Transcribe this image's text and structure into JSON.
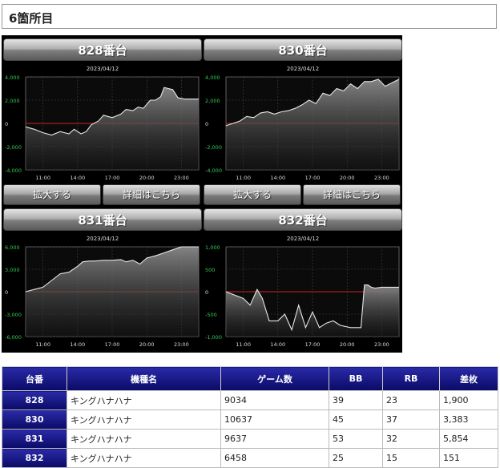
{
  "page": {
    "title": "6箇所目"
  },
  "colors": {
    "header_blue": "#0a0a66",
    "zero_line": "#cc2222",
    "axis_text": "#33cc55"
  },
  "slots": [
    {
      "label": "828番台",
      "date": "2023/04/12",
      "btn_zoom": "拡大する",
      "btn_detail": "詳細はこちら",
      "chart_data": {
        "type": "area",
        "y_ticks": [
          "4,000",
          "2,000",
          "0",
          "-2,000",
          "-4,000"
        ],
        "ylim": [
          -4000,
          4000
        ],
        "x_ticks": [
          "11:00",
          "14:00",
          "17:00",
          "20:00",
          "23:00"
        ],
        "x": [
          0,
          0.05,
          0.1,
          0.15,
          0.2,
          0.25,
          0.28,
          0.32,
          0.35,
          0.38,
          0.42,
          0.45,
          0.5,
          0.55,
          0.58,
          0.62,
          0.65,
          0.68,
          0.72,
          0.75,
          0.78,
          0.8,
          0.85,
          0.88,
          0.92,
          1
        ],
        "values": [
          -300,
          -500,
          -800,
          -1000,
          -700,
          -900,
          -500,
          -900,
          -700,
          -100,
          200,
          700,
          500,
          800,
          1200,
          1100,
          1400,
          1300,
          2000,
          2000,
          2300,
          3100,
          2900,
          2200,
          2100,
          2100
        ]
      }
    },
    {
      "label": "830番台",
      "date": "2023/04/12",
      "btn_zoom": "拡大する",
      "btn_detail": "詳細はこちら",
      "chart_data": {
        "type": "area",
        "y_ticks": [
          "4,000",
          "2,000",
          "0",
          "-2,000",
          "-4,000"
        ],
        "ylim": [
          -4000,
          4000
        ],
        "x_ticks": [
          "11:00",
          "14:00",
          "17:00",
          "20:00",
          "23:00"
        ],
        "x": [
          0,
          0.04,
          0.08,
          0.12,
          0.16,
          0.2,
          0.24,
          0.28,
          0.32,
          0.36,
          0.4,
          0.44,
          0.48,
          0.52,
          0.56,
          0.6,
          0.64,
          0.68,
          0.72,
          0.76,
          0.8,
          0.84,
          0.88,
          0.92,
          1
        ],
        "values": [
          -200,
          0,
          200,
          600,
          500,
          900,
          1000,
          800,
          1000,
          1100,
          1300,
          1600,
          2000,
          1700,
          2600,
          2400,
          3000,
          2800,
          3400,
          3000,
          3600,
          3600,
          3800,
          3200,
          3800
        ]
      }
    },
    {
      "label": "831番台",
      "date": "2023/04/12",
      "btn_zoom": "拡大する",
      "btn_detail": "詳細はこちら",
      "chart_data": {
        "type": "area",
        "y_ticks": [
          "6,000",
          "3,000",
          "0",
          "-3,000",
          "-6,000"
        ],
        "ylim": [
          -6000,
          6000
        ],
        "x_ticks": [
          "11:00",
          "14:00",
          "17:00",
          "20:00",
          "23:00"
        ],
        "x": [
          0,
          0.05,
          0.1,
          0.15,
          0.2,
          0.25,
          0.3,
          0.33,
          0.37,
          0.4,
          0.45,
          0.5,
          0.55,
          0.58,
          0.62,
          0.66,
          0.7,
          0.75,
          0.8,
          0.85,
          0.9,
          1
        ],
        "values": [
          0,
          300,
          600,
          1500,
          2400,
          2600,
          3400,
          4000,
          4100,
          4100,
          4200,
          4200,
          4300,
          4000,
          4200,
          3700,
          4500,
          4800,
          5200,
          5600,
          6000,
          6000
        ]
      }
    },
    {
      "label": "832番台",
      "date": "2023/04/12",
      "btn_zoom": "拡大する",
      "btn_detail": "詳細はこちら",
      "chart_data": {
        "type": "area",
        "y_ticks": [
          "1,000",
          "500",
          "0",
          "-500",
          "-1,000"
        ],
        "ylim": [
          -1000,
          1000
        ],
        "x_ticks": [
          "11:00",
          "14:00",
          "17:00",
          "20:00",
          "23:00"
        ],
        "x": [
          0,
          0.1,
          0.14,
          0.18,
          0.21,
          0.25,
          0.3,
          0.34,
          0.38,
          0.42,
          0.46,
          0.5,
          0.54,
          0.58,
          0.62,
          0.66,
          0.72,
          0.78,
          0.8,
          0.82,
          0.84,
          0.86,
          0.9,
          1
        ],
        "values": [
          0,
          -150,
          -300,
          50,
          -150,
          -650,
          -650,
          -500,
          -850,
          -300,
          -800,
          -450,
          -800,
          -700,
          -650,
          -750,
          -800,
          -800,
          150,
          150,
          100,
          80,
          100,
          100
        ]
      }
    }
  ],
  "table": {
    "headers": [
      "台番",
      "機種名",
      "ゲーム数",
      "BB",
      "RB",
      "差枚"
    ],
    "rows": [
      [
        "828",
        "キングハナハナ",
        "9034",
        "39",
        "23",
        "1,900"
      ],
      [
        "830",
        "キングハナハナ",
        "10637",
        "45",
        "37",
        "3,383"
      ],
      [
        "831",
        "キングハナハナ",
        "9637",
        "53",
        "32",
        "5,854"
      ],
      [
        "832",
        "キングハナハナ",
        "6458",
        "25",
        "15",
        "151"
      ]
    ]
  }
}
